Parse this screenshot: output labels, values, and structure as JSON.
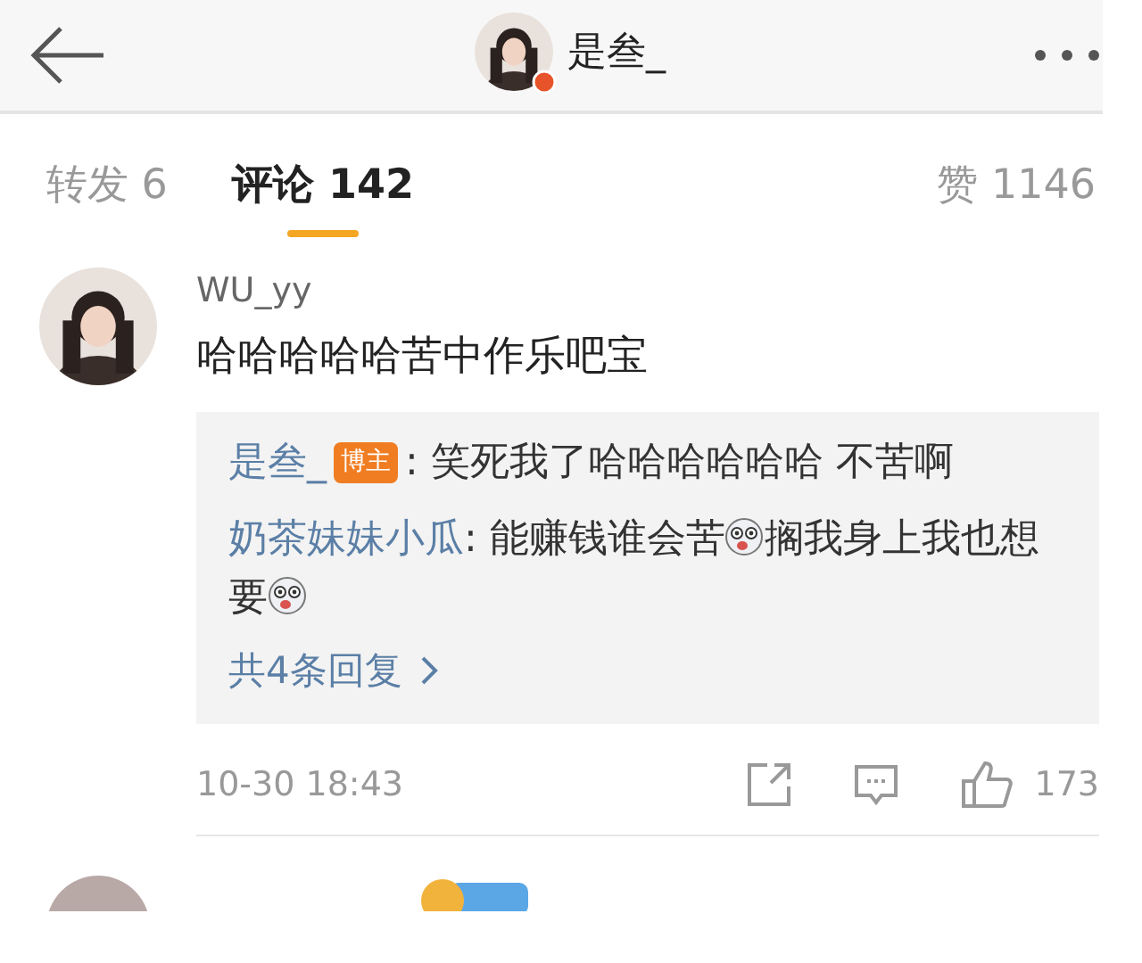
{
  "header": {
    "title": "是叁_"
  },
  "tabs": [
    {
      "label": "转发 6",
      "selected": false
    },
    {
      "label": "评论 142",
      "selected": true
    },
    {
      "label": "赞 1146",
      "selected": false
    }
  ],
  "comment": {
    "author": "WU_yy",
    "text": "哈哈哈哈哈苦中作乐吧宝",
    "replies": [
      {
        "author": "是叁_",
        "badge": "博主",
        "segments": [
          {
            "text": ": 笑死我了哈哈哈哈哈哈 不苦啊",
            "emoji": false
          }
        ]
      },
      {
        "author": "奶茶妹妹小瓜",
        "segments": [
          {
            "text": ": 能赚钱谁会苦",
            "emoji": true
          },
          {
            "text": "搁我身上我也想要",
            "emoji": true
          }
        ]
      }
    ],
    "more_replies": "共4条回复",
    "time": "10-30 18:43",
    "likes": "173"
  }
}
